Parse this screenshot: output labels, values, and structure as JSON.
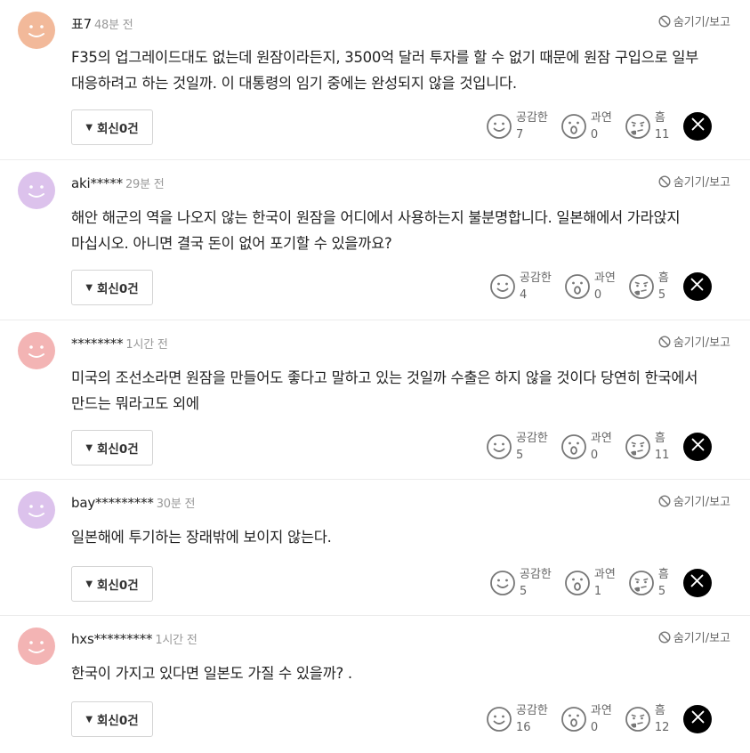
{
  "labels": {
    "hide_report": "숨기기/보고",
    "reply_label": "회신0건",
    "x_share_icon": "x-logo-icon"
  },
  "reaction_labels": [
    "공감한",
    "과연",
    "흠"
  ],
  "comments": [
    {
      "author": "표7",
      "time": "48분 전",
      "avatar_color": "#f2b99a",
      "text": "F35의 업그레이드대도 없는데 원잠이라든지, 3500억 달러 투자를 할 수 없기 때문에 원잠 구입으로 일부 대응하려고 하는 것일까. 이 대통령의 임기 중에는 완성되지 않을 것입니다.",
      "reactions": [
        7,
        0,
        11
      ]
    },
    {
      "author": "aki*****",
      "time": "29분 전",
      "avatar_color": "#dcc2ec",
      "text": "해안 해군의 역을 나오지 않는 한국이 원잠을 어디에서 사용하는지 불분명합니다. 일본해에서 가라앉지 마십시오. 아니면 결국 돈이 없어 포기할 수 있을까요?",
      "reactions": [
        4,
        0,
        5
      ]
    },
    {
      "author": "********",
      "time": "1시간 전",
      "avatar_color": "#f3b4b4",
      "text": "미국의 조선소라면 원잠을 만들어도 좋다고 말하고 있는 것일까 수출은 하지 않을 것이다 당연히 한국에서 만드는 뭐라고도 외에",
      "reactions": [
        5,
        0,
        11
      ]
    },
    {
      "author": "bay*********",
      "time": "30분 전",
      "avatar_color": "#dcc2ec",
      "text": "일본해에 투기하는 장래밖에 보이지 않는다.",
      "reactions": [
        5,
        1,
        5
      ]
    },
    {
      "author": "hxs*********",
      "time": "1시간 전",
      "avatar_color": "#f3b4b4",
      "text": "한국이 가지고 있다면 일본도 가질 수 있을까? .",
      "reactions": [
        16,
        0,
        12
      ]
    }
  ]
}
